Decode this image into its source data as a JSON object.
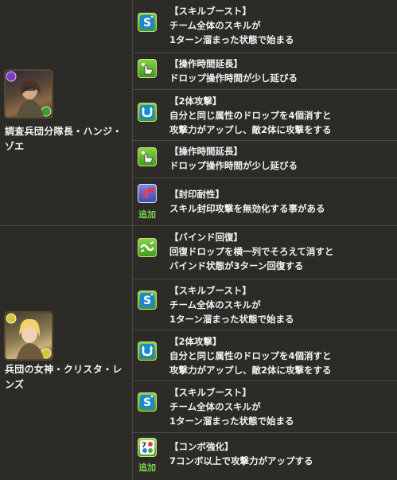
{
  "characters": [
    {
      "name": "調査兵団分隊長・ハンジ・ゾエ",
      "portrait_icon": "hange-portrait-icon"
    },
    {
      "name": "兵団の女神・クリスタ・レンズ",
      "portrait_icon": "krista-portrait-icon"
    }
  ],
  "added_label": "追加",
  "awakenings": [
    {
      "icon": "skill-boost-icon",
      "title": "【スキルブースト】",
      "desc": "チーム全体のスキルが\n1ターン溜まった状態で始まる"
    },
    {
      "icon": "extend-time-icon",
      "title": "【操作時間延長】",
      "desc": "ドロップ操作時間が少し延びる"
    },
    {
      "icon": "two-pronged-attack-icon",
      "title": "【2体攻撃】",
      "desc": "自分と同じ属性のドロップを4個消すと\n攻撃力がアップし、敵2体に攻撃をする"
    },
    {
      "icon": "extend-time-icon",
      "title": "【操作時間延長】",
      "desc": "ドロップ操作時間が少し延びる"
    },
    {
      "icon": "skill-bind-resist-icon",
      "title": "【封印耐性】",
      "desc": "スキル封印攻撃を無効化する事がある",
      "added": true
    },
    {
      "icon": "recover-bind-icon",
      "title": "【バインド回復】",
      "desc": "回復ドロップを横一列でそろえて消すと\nバインド状態が3ターン回復する"
    },
    {
      "icon": "skill-boost-icon",
      "title": "【スキルブースト】",
      "desc": "チーム全体のスキルが\n1ターン溜まった状態で始まる"
    },
    {
      "icon": "two-pronged-attack-icon",
      "title": "【2体攻撃】",
      "desc": "自分と同じ属性のドロップを4個消すと\n攻撃力がアップし、敵2体に攻撃をする"
    },
    {
      "icon": "skill-boost-icon",
      "title": "【スキルブースト】",
      "desc": "チーム全体のスキルが\n1ターン溜まった状態で始まる"
    },
    {
      "icon": "enhanced-combo-icon",
      "title": "【コンボ強化】",
      "desc": "7コンボ以上で攻撃力がアップする",
      "added": true
    }
  ]
}
